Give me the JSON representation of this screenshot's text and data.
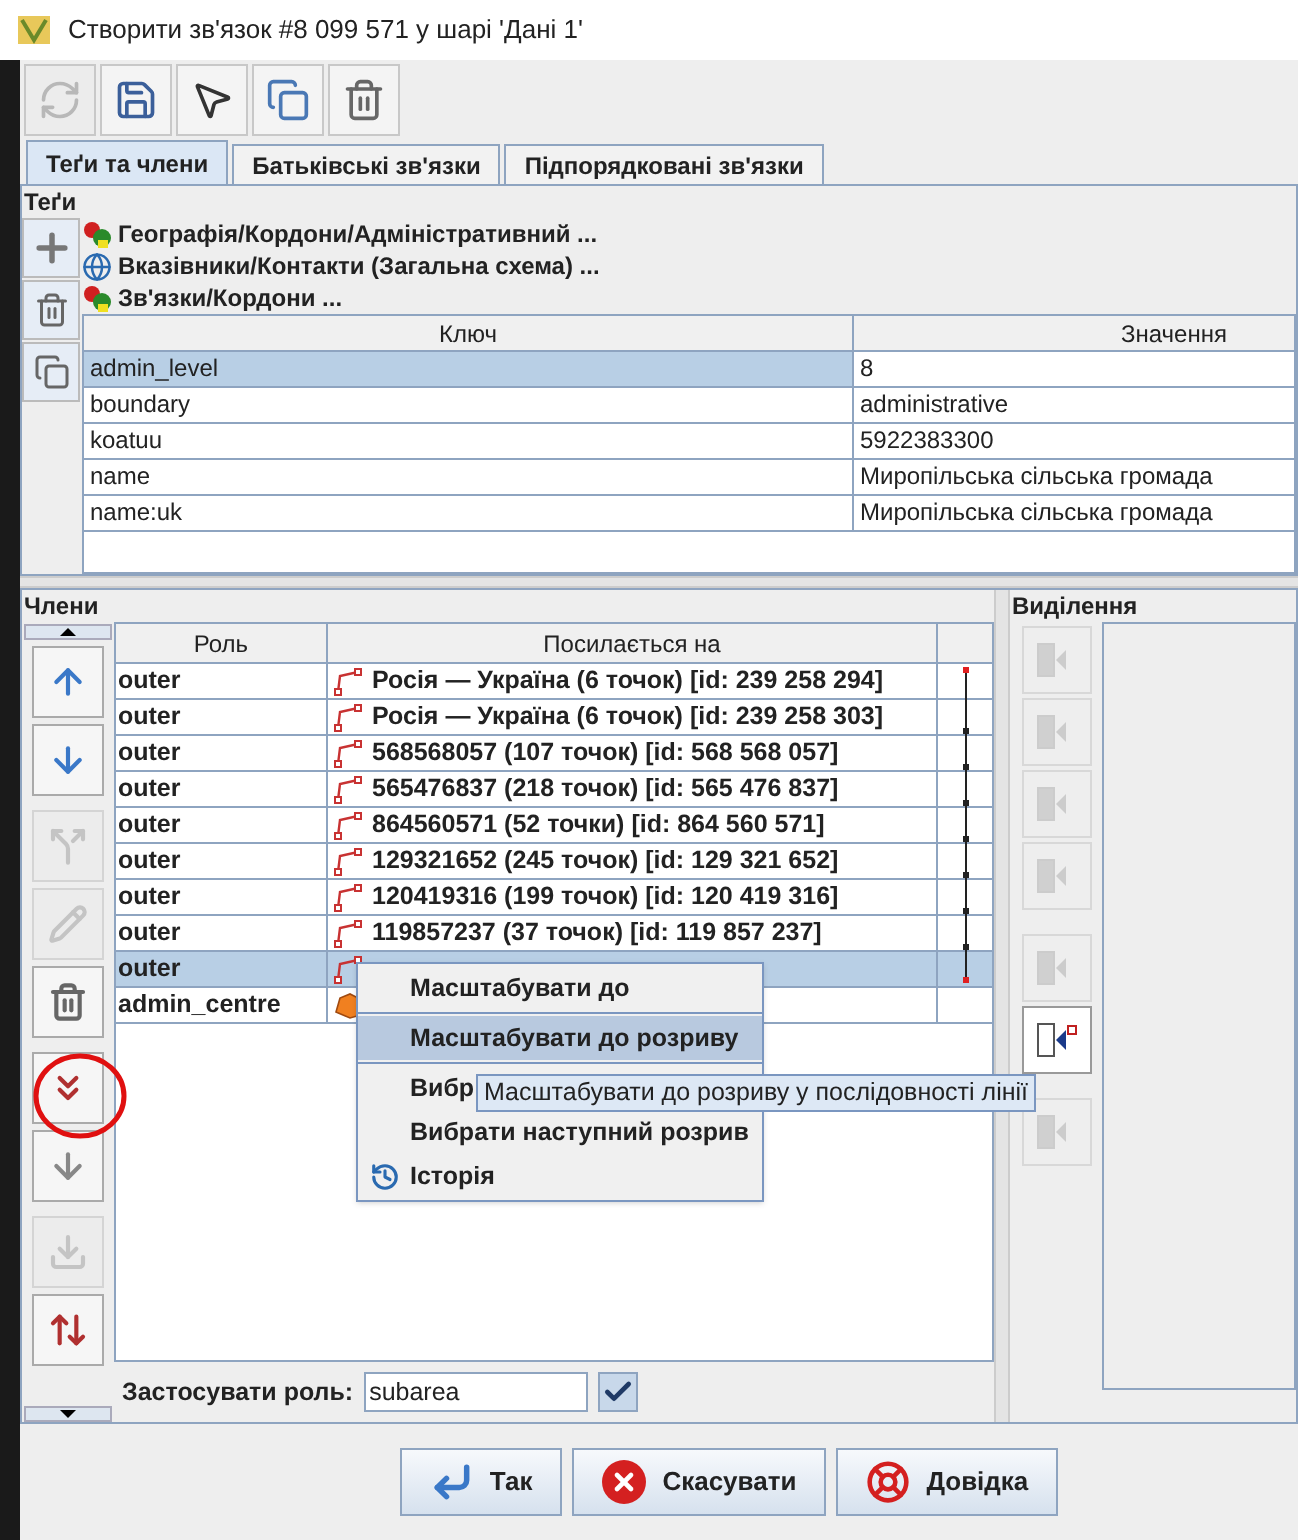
{
  "window": {
    "title": "Створити зв'язок #8 099 571 у шарі 'Дані 1'"
  },
  "toolbar": [
    {
      "kind": "refresh",
      "disabled": true
    },
    {
      "kind": "save",
      "disabled": false
    },
    {
      "kind": "select",
      "disabled": false
    },
    {
      "kind": "duplicate",
      "disabled": false
    },
    {
      "kind": "delete",
      "disabled": false
    }
  ],
  "tabs": [
    {
      "label": "Теґи та члени",
      "selected": true
    },
    {
      "label": "Батьківські зв'язки",
      "selected": false
    },
    {
      "label": "Підпорядковані зв'язки",
      "selected": false
    }
  ],
  "tags": {
    "label": "Теґи",
    "presets": [
      {
        "label": "Географія/Кордони/Адміністративний ...",
        "kind": "preset"
      },
      {
        "label": "Вказівники/Контакти (Загальна схема) ...",
        "kind": "globe"
      },
      {
        "label": "Зв'язки/Кордони ...",
        "kind": "preset"
      }
    ],
    "columns": [
      "Ключ",
      "Значення"
    ],
    "rows": [
      {
        "key": "admin_level",
        "value": "8",
        "selected": true
      },
      {
        "key": "boundary",
        "value": "administrative",
        "selected": false
      },
      {
        "key": "koatuu",
        "value": "5922383300",
        "selected": false
      },
      {
        "key": "name",
        "value": "Миропільська сільська громада",
        "selected": false
      },
      {
        "key": "name:uk",
        "value": "Миропільська сільська громада",
        "selected": false
      }
    ]
  },
  "members": {
    "label": "Члени",
    "columns": [
      "Роль",
      "Посилається на"
    ],
    "rows": [
      {
        "role": "outer",
        "ref": "Росія — Україна (6 точок) [id: 239 258 294]",
        "kind": "way",
        "selected": false
      },
      {
        "role": "outer",
        "ref": "Росія — Україна (6 точок) [id: 239 258 303]",
        "kind": "way",
        "selected": false
      },
      {
        "role": "outer",
        "ref": "568568057 (107 точок) [id: 568 568 057]",
        "kind": "way",
        "selected": false
      },
      {
        "role": "outer",
        "ref": "565476837 (218 точок) [id: 565 476 837]",
        "kind": "way",
        "selected": false
      },
      {
        "role": "outer",
        "ref": "864560571 (52 точки) [id: 864 560 571]",
        "kind": "way",
        "selected": false
      },
      {
        "role": "outer",
        "ref": "129321652 (245 точок) [id: 129 321 652]",
        "kind": "way",
        "selected": false
      },
      {
        "role": "outer",
        "ref": "120419316 (199 точок) [id: 120 419 316]",
        "kind": "way",
        "selected": false
      },
      {
        "role": "outer",
        "ref": "119857237 (37 точок) [id: 119 857 237]",
        "kind": "way",
        "selected": false
      },
      {
        "role": "outer",
        "kind": "way",
        "selected": true
      },
      {
        "role": "admin_centre",
        "kind": "area",
        "selected": false
      }
    ],
    "buttons": [
      {
        "kind": "up",
        "disabled": false
      },
      {
        "kind": "down",
        "disabled": false
      },
      {
        "kind": "reverse",
        "disabled": true
      },
      {
        "kind": "edit",
        "disabled": true
      },
      {
        "kind": "delete",
        "disabled": false
      },
      {
        "kind": "sort",
        "disabled": false
      },
      {
        "kind": "sort2",
        "disabled": false
      },
      {
        "kind": "download",
        "disabled": true
      },
      {
        "kind": "reverse2",
        "disabled": false
      }
    ],
    "role_label": "Застосувати роль:",
    "role_value": "subarea"
  },
  "selection": {
    "label": "Виділення",
    "buttons": [
      {
        "disabled": true
      },
      {
        "disabled": true
      },
      {
        "disabled": true
      },
      {
        "disabled": true
      },
      {
        "disabled": true
      },
      {
        "disabled": false
      },
      {
        "disabled": true
      }
    ]
  },
  "context_menu": {
    "items": [
      {
        "kind": "item",
        "label": "Масштабувати до",
        "selected": false
      },
      {
        "kind": "separator"
      },
      {
        "kind": "item",
        "label": "Масштабувати до розриву",
        "selected": true
      },
      {
        "kind": "separator"
      },
      {
        "kind": "item",
        "label": "Вибр",
        "selected": false
      },
      {
        "kind": "item",
        "label": "Вибрати наступний розрив",
        "selected": false
      },
      {
        "kind": "history",
        "label": "Історія",
        "selected": false
      }
    ],
    "tooltip": "Масштабувати до розриву у послідовності лінії"
  },
  "buttons": [
    {
      "kind": "ok",
      "label": "Так"
    },
    {
      "kind": "cancel",
      "label": "Скасувати"
    },
    {
      "kind": "help",
      "label": "Довідка"
    }
  ]
}
